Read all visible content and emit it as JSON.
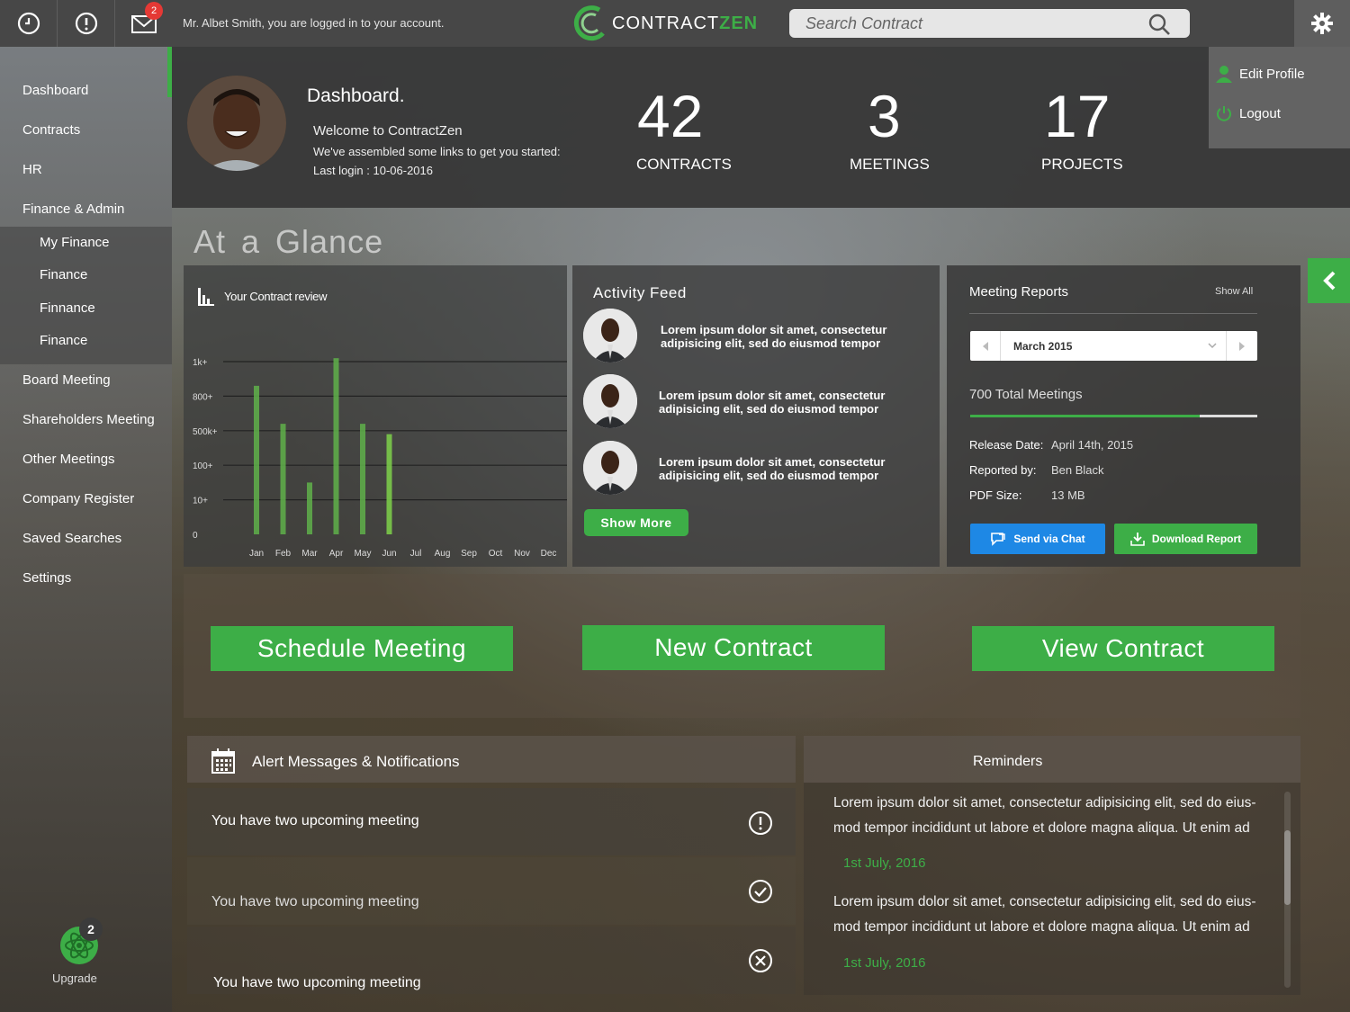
{
  "topbar": {
    "notification_count": "2",
    "welcome_text": "Mr. Albet Smith, you are logged in to your account.",
    "logo_contract": "CONTRACT",
    "logo_zen": "ZEN",
    "search_placeholder": "Search Contract"
  },
  "sidebar": {
    "items": [
      "Dashboard",
      "Contracts",
      "HR",
      "Finance & Admin"
    ],
    "sub_items": [
      "My Finance",
      "Finance",
      "Finnance",
      "Finance"
    ],
    "items_after": [
      "Board Meeting",
      "Shareholders Meeting",
      "Other Meetings",
      "Company Register",
      "Saved Searches",
      "Settings"
    ],
    "upgrade_count": "2",
    "upgrade_label": "Upgrade"
  },
  "header": {
    "title": "Dashboard.",
    "welcome": "Welcome to ContractZen",
    "subtitle": "We've assembled some links to get you started:",
    "last_login": "Last login : 10-06-2016",
    "stats": [
      {
        "value": "42",
        "label": "CONTRACTS"
      },
      {
        "value": "3",
        "label": "MEETINGS"
      },
      {
        "value": "17",
        "label": "PROJECTS"
      }
    ]
  },
  "profile_menu": {
    "edit": "Edit Profile",
    "logout": "Logout"
  },
  "glance_title": "At a Glance",
  "chart_data": {
    "type": "bar",
    "title": "Your Contract review",
    "categories": [
      "Jan",
      "Feb",
      "Mar",
      "Apr",
      "May",
      "Jun",
      "Jul",
      "Aug",
      "Sep",
      "Oct",
      "Nov",
      "Dec"
    ],
    "y_ticks": [
      "0",
      "10+",
      "100+",
      "500k+",
      "800+",
      "1k+"
    ],
    "values": [
      4.3,
      3.2,
      1.5,
      5.1,
      3.2,
      2.9,
      0,
      0,
      0,
      0,
      0,
      0
    ],
    "ylim": [
      0,
      5
    ],
    "grid": true,
    "color": "#5fb04a"
  },
  "activity": {
    "title": "Activity Feed",
    "items": [
      "Lorem ipsum dolor sit amet, consectetur adipisicing elit, sed do eiusmod tempor",
      "Lorem ipsum dolor sit amet, consectetur adipisicing elit, sed do eiusmod tempor",
      "Lorem ipsum dolor sit amet, consectetur adipisicing elit, sed do eiusmod tempor"
    ],
    "show_more": "Show More"
  },
  "meetings": {
    "title": "Meeting Reports",
    "show_all": "Show All",
    "month": "March 2015",
    "total": "700 Total Meetings",
    "progress": 0.8,
    "release_label": "Release Date:",
    "release_value": "April 14th, 2015",
    "reported_label": "Reported by:",
    "reported_value": "Ben Black",
    "pdf_label": "PDF Size:",
    "pdf_value": "13 MB",
    "send_chat": "Send via Chat",
    "download": "Download Report"
  },
  "actions": {
    "schedule": "Schedule Meeting",
    "new_contract": "New Contract",
    "view_contract": "View Contract"
  },
  "alerts": {
    "title": "Alert Messages & Notifications",
    "items": [
      "You have two upcoming meeting",
      "You have two upcoming meeting",
      "You have two upcoming meeting"
    ]
  },
  "reminders": {
    "title": "Reminders",
    "items": [
      {
        "text": "Lorem ipsum dolor sit amet, consectetur adipisicing elit, sed do eius- mod tempor incididunt ut labore et dolore magna aliqua. Ut enim ad",
        "date": "1st July, 2016"
      },
      {
        "text": "Lorem ipsum dolor sit amet, consectetur adipisicing elit, sed do eius- mod tempor incididunt ut labore et dolore magna aliqua. Ut enim ad",
        "date": "1st July, 2016"
      }
    ]
  },
  "colors": {
    "accent": "#3dae47",
    "blue": "#1e88e5",
    "badge": "#e53935"
  }
}
